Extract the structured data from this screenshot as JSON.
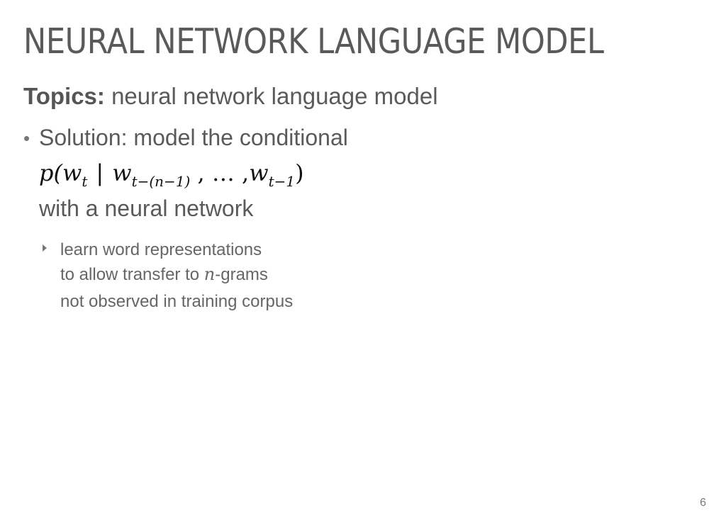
{
  "slide": {
    "title": "NEURAL NETWORK LANGUAGE MODEL",
    "topics_label": "Topics:",
    "topics_text": "neural network language model",
    "bullet": {
      "line1": "Solution: model the conditional",
      "formula": {
        "p": "p(",
        "w_t": "w",
        "w_t_sub": "t",
        "bar": "|",
        "w_prev": "w",
        "w_prev_sub": "t−(n−1)",
        "sep1": " , … ,",
        "w_last": "w",
        "w_last_sub": "t−1",
        "close": ")"
      },
      "line3": "with a neural network"
    },
    "sub_bullet": {
      "line1": "learn word representations",
      "line2_pre": "to allow transfer to ",
      "line2_var": "n",
      "line2_post": "-grams",
      "line3": "not observed in training corpus"
    },
    "page_number": "6"
  }
}
